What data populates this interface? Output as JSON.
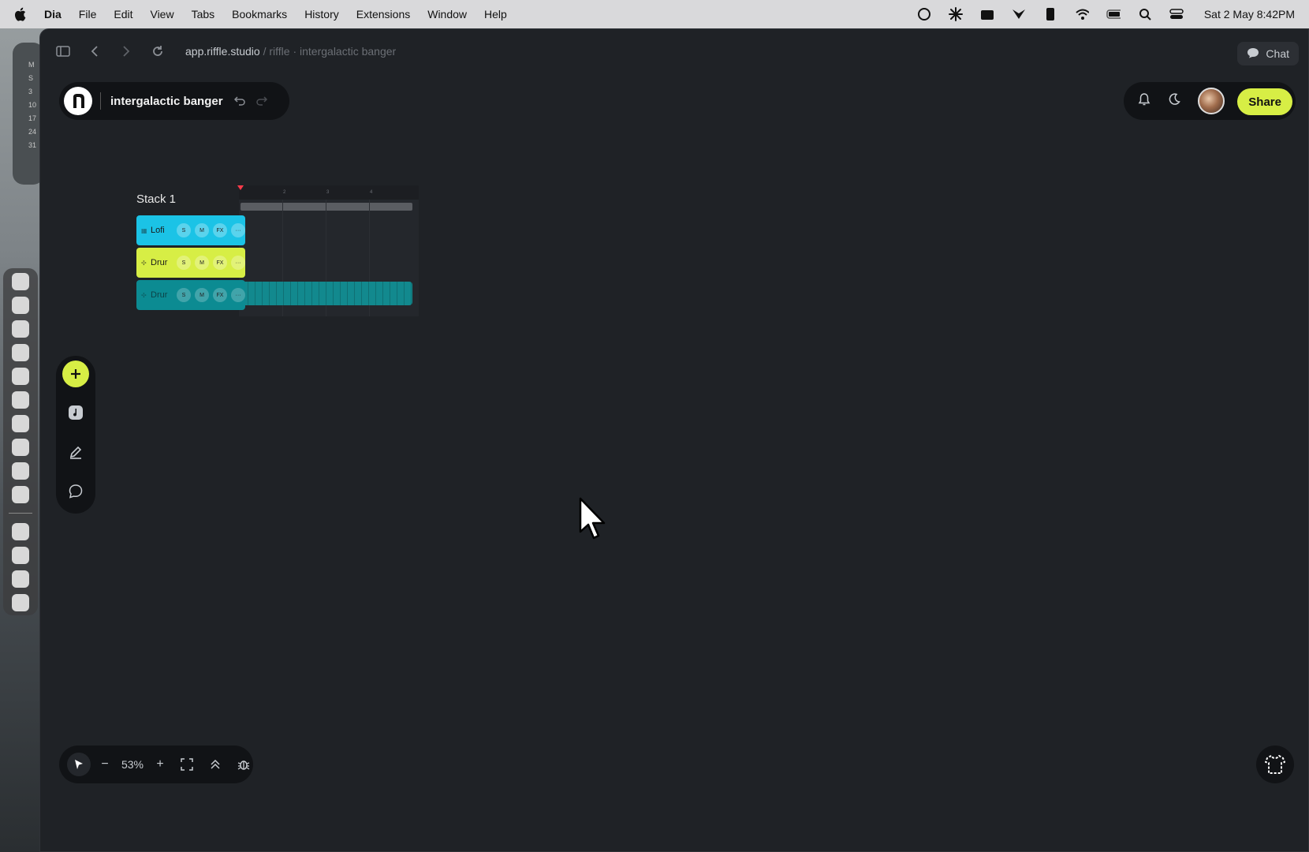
{
  "menubar": {
    "app": "Dia",
    "items": [
      "File",
      "Edit",
      "View",
      "Tabs",
      "Bookmarks",
      "History",
      "Extensions",
      "Window",
      "Help"
    ],
    "clock": "Sat 2 May  8:42PM"
  },
  "calendar_widget": {
    "lines": [
      "M",
      "S",
      "",
      "3",
      "10",
      "17",
      "24",
      "31"
    ]
  },
  "browser": {
    "url_host": "app.riffle.studio",
    "url_path": " / riffle · intergalactic banger",
    "chat_label": "Chat"
  },
  "project": {
    "name": "intergalactic banger"
  },
  "actions": {
    "share_label": "Share"
  },
  "stack": {
    "title": "Stack 1",
    "ruler_ticks": [
      "2",
      "3",
      "4"
    ],
    "tracks": [
      {
        "name": "Lofi",
        "solo": "S",
        "mute": "M",
        "fx": "FX",
        "more": "···",
        "color": "#1bc3e6"
      },
      {
        "name": "Drur",
        "solo": "S",
        "mute": "M",
        "fx": "FX",
        "more": "···",
        "color": "#d7ee45"
      },
      {
        "name": "Drur",
        "solo": "S",
        "mute": "M",
        "fx": "FX",
        "more": "···",
        "color": "#0c8b92"
      }
    ]
  },
  "zoom": {
    "minus": "−",
    "value": "53%",
    "plus": "+"
  },
  "colors": {
    "accent": "#d7ee45",
    "canvas": "#1f2226",
    "panel": "#111316"
  }
}
